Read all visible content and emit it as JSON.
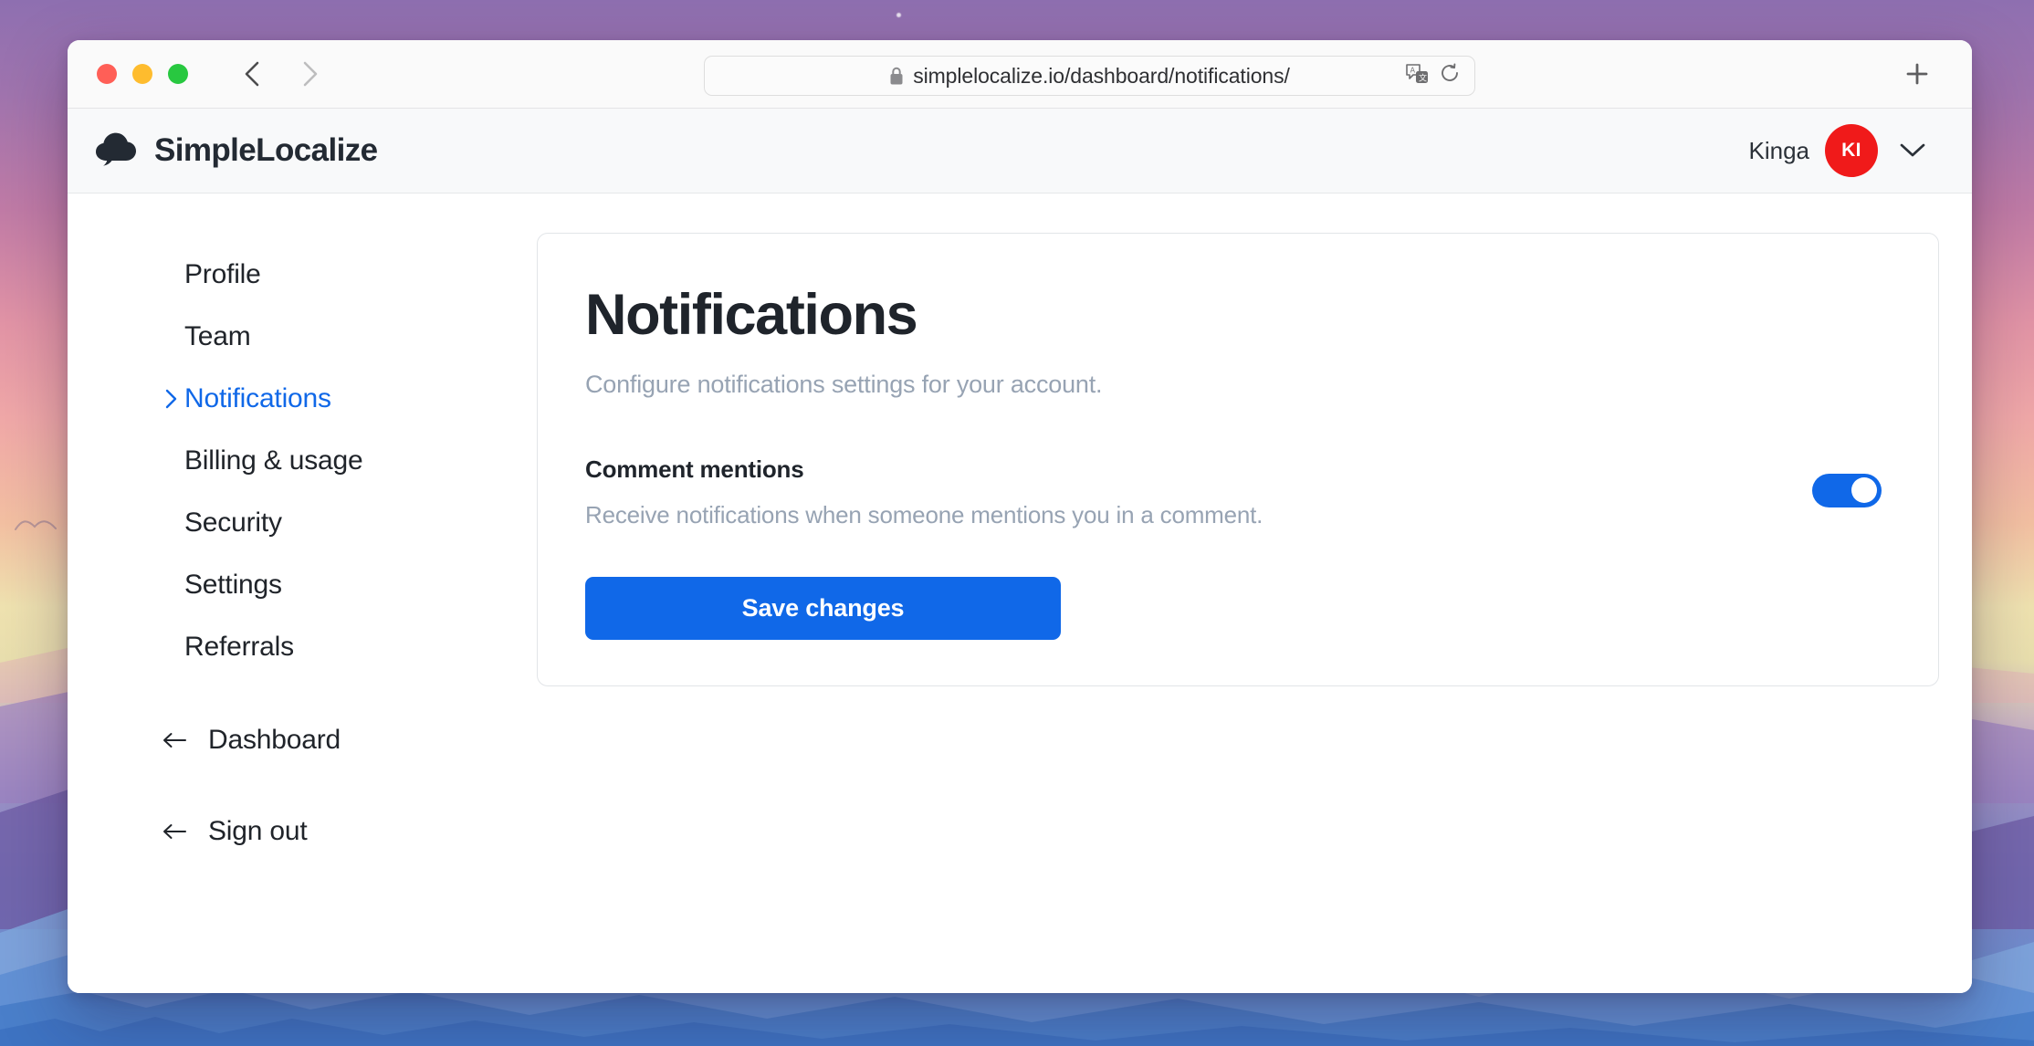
{
  "browser": {
    "traffic_lights": [
      "close",
      "minimize",
      "maximize"
    ],
    "back_label": "Back",
    "forward_label": "Forward",
    "url": "simplelocalize.io/dashboard/notifications/",
    "lock_icon": "lock-icon",
    "translate_icon": "translate-icon",
    "reload_icon": "reload-icon",
    "new_tab_label": "+",
    "colors": {
      "close": "#ff5f57",
      "minimize": "#febc2e",
      "maximize": "#28c840"
    }
  },
  "app_header": {
    "logo_icon": "simplelocalize-cloud-logo",
    "brand": "SimpleLocalize",
    "user_name": "Kinga",
    "avatar_initials": "KI",
    "avatar_color": "#f01a1a",
    "caret_icon": "chevron-down-icon"
  },
  "sidebar": {
    "items": [
      {
        "label": "Profile",
        "active": false
      },
      {
        "label": "Team",
        "active": false
      },
      {
        "label": "Notifications",
        "active": true
      },
      {
        "label": "Billing & usage",
        "active": false
      },
      {
        "label": "Security",
        "active": false
      },
      {
        "label": "Settings",
        "active": false
      },
      {
        "label": "Referrals",
        "active": false
      }
    ],
    "active_chevron_icon": "chevron-right-icon",
    "bottom_links": [
      {
        "label": "Dashboard",
        "icon": "arrow-left-icon"
      },
      {
        "label": "Sign out",
        "icon": "arrow-left-icon"
      }
    ]
  },
  "main": {
    "title": "Notifications",
    "subtitle": "Configure notifications settings for your account.",
    "settings": [
      {
        "label": "Comment mentions",
        "description": "Receive notifications when someone mentions you in a comment.",
        "toggle_on": true
      }
    ],
    "save_label": "Save changes",
    "accent_color": "#1068e8"
  }
}
